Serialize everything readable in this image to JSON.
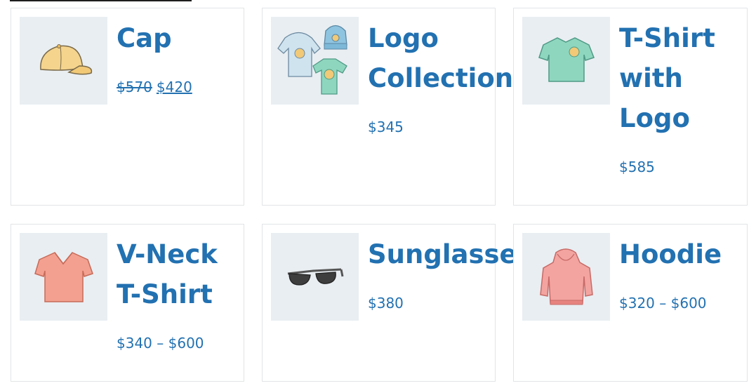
{
  "products": [
    {
      "name": "Cap",
      "price_regular": "$570",
      "price_sale": "$420",
      "icon": "cap-image"
    },
    {
      "name_lines": [
        "Logo",
        "Collection"
      ],
      "price": "$345",
      "icon": "logo-collection-image"
    },
    {
      "name_lines": [
        "T-Shirt",
        "with",
        "Logo"
      ],
      "price": "$585",
      "icon": "tshirt-with-logo-image"
    },
    {
      "name_lines": [
        "V-Neck",
        "T-Shirt"
      ],
      "price": "$340 – $600",
      "icon": "vneck-tshirt-image"
    },
    {
      "name": "Sunglasses",
      "price": "$380",
      "icon": "sunglasses-image"
    },
    {
      "name": "Hoodie",
      "price": "$320 – $600",
      "icon": "hoodie-image"
    }
  ],
  "colors": {
    "link": "#2271b1",
    "thumb_bg": "#e9eef2",
    "border": "#e2e4e7"
  }
}
